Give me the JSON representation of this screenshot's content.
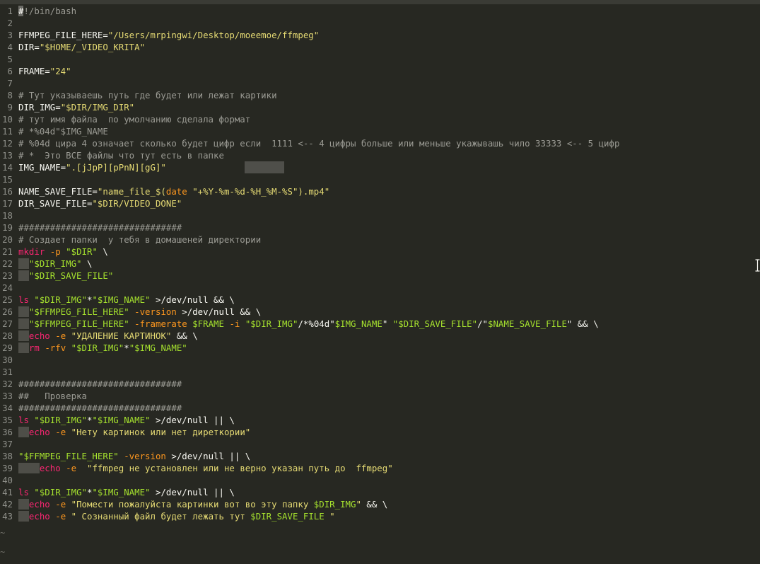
{
  "editor": {
    "lines": [
      {
        "n": "1",
        "tokens": [
          {
            "t": "#",
            "c": "cursor"
          },
          {
            "t": "!/bin/bash",
            "c": "cm"
          }
        ]
      },
      {
        "n": "2",
        "tokens": []
      },
      {
        "n": "3",
        "tokens": [
          {
            "t": "FFMPEG_FILE_HERE=",
            "c": "pl"
          },
          {
            "t": "\"/Users/mrpingwi/Desktop/moeemoe/ffmpeg\"",
            "c": "st"
          }
        ]
      },
      {
        "n": "4",
        "tokens": [
          {
            "t": "DIR=",
            "c": "pl"
          },
          {
            "t": "\"$HOME/_VIDEO_KRITA\"",
            "c": "st"
          }
        ]
      },
      {
        "n": "5",
        "tokens": []
      },
      {
        "n": "6",
        "tokens": [
          {
            "t": "FRAME=",
            "c": "pl"
          },
          {
            "t": "\"24\"",
            "c": "st"
          }
        ]
      },
      {
        "n": "7",
        "tokens": []
      },
      {
        "n": "8",
        "tokens": [
          {
            "t": "# Тут указываешь путь где будет или лежат картики",
            "c": "cm"
          }
        ]
      },
      {
        "n": "9",
        "tokens": [
          {
            "t": "DIR_IMG=",
            "c": "pl"
          },
          {
            "t": "\"$DIR/IMG_DIR\"",
            "c": "st"
          }
        ]
      },
      {
        "n": "10",
        "tokens": [
          {
            "t": "# тут имя файла  по умолчанию сделала формат",
            "c": "cm"
          }
        ]
      },
      {
        "n": "11",
        "tokens": [
          {
            "t": "# *%04d\"$IMG_NAME",
            "c": "cm"
          }
        ]
      },
      {
        "n": "12",
        "tokens": [
          {
            "t": "# %04d цира 4 означает сколько будет цифр если  1111 <-- 4 цифры больше или меньше укажывашь чило 33333 <-- 5 цифр",
            "c": "cm"
          }
        ]
      },
      {
        "n": "13",
        "tokens": [
          {
            "t": "# *  Это ВСЕ файлы что тут есть в папке",
            "c": "cm"
          }
        ]
      },
      {
        "n": "14",
        "tokens": [
          {
            "t": "IMG_NAME=",
            "c": "pl"
          },
          {
            "t": "\".[jJpP][pPnN][gG]\"",
            "c": "st"
          }
        ]
      },
      {
        "n": "15",
        "tokens": []
      },
      {
        "n": "16",
        "tokens": [
          {
            "t": "NAME_SAVE_FILE=",
            "c": "pl"
          },
          {
            "t": "\"name_file_$(",
            "c": "st"
          },
          {
            "t": "date",
            "c": "op"
          },
          {
            "t": " ",
            "c": "pl"
          },
          {
            "t": "\"+%Y-%m-%d-%H_%M-%S\"",
            "c": "st"
          },
          {
            "t": ").mp4\"",
            "c": "st"
          }
        ]
      },
      {
        "n": "17",
        "tokens": [
          {
            "t": "DIR_SAVE_FILE=",
            "c": "pl"
          },
          {
            "t": "\"$DIR/VIDEO_DONE\"",
            "c": "st"
          }
        ]
      },
      {
        "n": "18",
        "tokens": []
      },
      {
        "n": "19",
        "tokens": [
          {
            "t": "###############################",
            "c": "cm"
          }
        ]
      },
      {
        "n": "20",
        "tokens": [
          {
            "t": "# Создает папки  у тебя в домашеней директории",
            "c": "cm"
          }
        ]
      },
      {
        "n": "21",
        "tokens": [
          {
            "t": "mkdir",
            "c": "cd"
          },
          {
            "t": " ",
            "c": "pl"
          },
          {
            "t": "-p",
            "c": "op"
          },
          {
            "t": " ",
            "c": "pl"
          },
          {
            "t": "\"$DIR\"",
            "c": "vr"
          },
          {
            "t": " \\",
            "c": "pl"
          }
        ]
      },
      {
        "n": "22",
        "tokens": [
          {
            "t": "  ",
            "c": "ws"
          },
          {
            "t": "\"$DIR_IMG\"",
            "c": "vr"
          },
          {
            "t": " \\",
            "c": "pl"
          }
        ]
      },
      {
        "n": "23",
        "tokens": [
          {
            "t": "  ",
            "c": "ws"
          },
          {
            "t": "\"$DIR_SAVE_FILE\"",
            "c": "vr"
          }
        ]
      },
      {
        "n": "24",
        "tokens": []
      },
      {
        "n": "25",
        "tokens": [
          {
            "t": "ls",
            "c": "cd"
          },
          {
            "t": " ",
            "c": "pl"
          },
          {
            "t": "\"$DIR_IMG\"",
            "c": "vr"
          },
          {
            "t": "*",
            "c": "pl"
          },
          {
            "t": "\"$IMG_NAME\"",
            "c": "vr"
          },
          {
            "t": " >/dev/null && \\",
            "c": "pl"
          }
        ]
      },
      {
        "n": "26",
        "tokens": [
          {
            "t": "  ",
            "c": "ws"
          },
          {
            "t": "\"$FFMPEG_FILE_HERE\"",
            "c": "vr"
          },
          {
            "t": " ",
            "c": "pl"
          },
          {
            "t": "-version",
            "c": "op"
          },
          {
            "t": " >/dev/null && \\",
            "c": "pl"
          }
        ]
      },
      {
        "n": "27",
        "tokens": [
          {
            "t": "  ",
            "c": "ws"
          },
          {
            "t": "\"$FFMPEG_FILE_HERE\"",
            "c": "vr"
          },
          {
            "t": " ",
            "c": "pl"
          },
          {
            "t": "-framerate",
            "c": "op"
          },
          {
            "t": " ",
            "c": "pl"
          },
          {
            "t": "$FRAME",
            "c": "vr"
          },
          {
            "t": " ",
            "c": "pl"
          },
          {
            "t": "-i",
            "c": "op"
          },
          {
            "t": " ",
            "c": "pl"
          },
          {
            "t": "\"$DIR_IMG\"",
            "c": "vr"
          },
          {
            "t": "/*%04d\"",
            "c": "pl"
          },
          {
            "t": "$IMG_NAME",
            "c": "vr"
          },
          {
            "t": "\" ",
            "c": "pl"
          },
          {
            "t": "\"$DIR_SAVE_FILE\"",
            "c": "vr"
          },
          {
            "t": "/\"",
            "c": "pl"
          },
          {
            "t": "$NAME_SAVE_FILE",
            "c": "vr"
          },
          {
            "t": "\" && \\",
            "c": "pl"
          }
        ]
      },
      {
        "n": "28",
        "tokens": [
          {
            "t": "  ",
            "c": "ws"
          },
          {
            "t": "echo",
            "c": "cd"
          },
          {
            "t": " ",
            "c": "pl"
          },
          {
            "t": "-e",
            "c": "op"
          },
          {
            "t": " ",
            "c": "pl"
          },
          {
            "t": "\"УДАЛЕНИЕ КАРТИНОК\"",
            "c": "st"
          },
          {
            "t": " && \\",
            "c": "pl"
          }
        ]
      },
      {
        "n": "29",
        "tokens": [
          {
            "t": "  ",
            "c": "ws"
          },
          {
            "t": "rm",
            "c": "cd"
          },
          {
            "t": " ",
            "c": "pl"
          },
          {
            "t": "-rfv",
            "c": "op"
          },
          {
            "t": " ",
            "c": "pl"
          },
          {
            "t": "\"$DIR_IMG\"",
            "c": "vr"
          },
          {
            "t": "*",
            "c": "pl"
          },
          {
            "t": "\"$IMG_NAME\"",
            "c": "vr"
          }
        ]
      },
      {
        "n": "30",
        "tokens": []
      },
      {
        "n": "31",
        "tokens": []
      },
      {
        "n": "32",
        "tokens": [
          {
            "t": "###############################",
            "c": "cm"
          }
        ]
      },
      {
        "n": "33",
        "tokens": [
          {
            "t": "##   Проверка",
            "c": "cm"
          }
        ]
      },
      {
        "n": "34",
        "tokens": [
          {
            "t": "###############################",
            "c": "cm"
          }
        ]
      },
      {
        "n": "35",
        "tokens": [
          {
            "t": "ls",
            "c": "cd"
          },
          {
            "t": " ",
            "c": "pl"
          },
          {
            "t": "\"$DIR_IMG\"",
            "c": "vr"
          },
          {
            "t": "*",
            "c": "pl"
          },
          {
            "t": "\"$IMG_NAME\"",
            "c": "vr"
          },
          {
            "t": " >/dev/null || \\",
            "c": "pl"
          }
        ]
      },
      {
        "n": "36",
        "tokens": [
          {
            "t": "  ",
            "c": "ws"
          },
          {
            "t": "echo",
            "c": "cd"
          },
          {
            "t": " ",
            "c": "pl"
          },
          {
            "t": "-e",
            "c": "op"
          },
          {
            "t": " ",
            "c": "pl"
          },
          {
            "t": "\"Нету картинок или нет диреткории\"",
            "c": "st"
          }
        ]
      },
      {
        "n": "37",
        "tokens": []
      },
      {
        "n": "38",
        "tokens": [
          {
            "t": "\"$FFMPEG_FILE_HERE\"",
            "c": "vr"
          },
          {
            "t": " ",
            "c": "pl"
          },
          {
            "t": "-version",
            "c": "op"
          },
          {
            "t": " >/dev/null || \\",
            "c": "pl"
          }
        ]
      },
      {
        "n": "39",
        "tokens": [
          {
            "t": "    ",
            "c": "ws"
          },
          {
            "t": "echo",
            "c": "cd"
          },
          {
            "t": " ",
            "c": "pl"
          },
          {
            "t": "-e",
            "c": "op"
          },
          {
            "t": "  ",
            "c": "pl"
          },
          {
            "t": "\"ffmpeg не установлен или не верно указан путь до  ffmpeg\"",
            "c": "st"
          }
        ]
      },
      {
        "n": "40",
        "tokens": []
      },
      {
        "n": "41",
        "tokens": [
          {
            "t": "ls",
            "c": "cd"
          },
          {
            "t": " ",
            "c": "pl"
          },
          {
            "t": "\"$DIR_IMG\"",
            "c": "vr"
          },
          {
            "t": "*",
            "c": "pl"
          },
          {
            "t": "\"$IMG_NAME\"",
            "c": "vr"
          },
          {
            "t": " >/dev/null || \\",
            "c": "pl"
          }
        ]
      },
      {
        "n": "42",
        "tokens": [
          {
            "t": "  ",
            "c": "ws"
          },
          {
            "t": "echo",
            "c": "cd"
          },
          {
            "t": " ",
            "c": "pl"
          },
          {
            "t": "-e",
            "c": "op"
          },
          {
            "t": " ",
            "c": "pl"
          },
          {
            "t": "\"Помести пожалуйста картинки вот во эту папку ",
            "c": "st"
          },
          {
            "t": "$DIR_IMG",
            "c": "vr"
          },
          {
            "t": "\"",
            "c": "st"
          },
          {
            "t": " && \\",
            "c": "pl"
          }
        ]
      },
      {
        "n": "43",
        "tokens": [
          {
            "t": "  ",
            "c": "ws"
          },
          {
            "t": "echo",
            "c": "cd"
          },
          {
            "t": " ",
            "c": "pl"
          },
          {
            "t": "-e",
            "c": "op"
          },
          {
            "t": " ",
            "c": "pl"
          },
          {
            "t": "\" Сознанный файл будет лежать тут ",
            "c": "st"
          },
          {
            "t": "$DIR_SAVE_FILE",
            "c": "vr"
          },
          {
            "t": " \"",
            "c": "st"
          }
        ]
      }
    ],
    "tildes": [
      "~",
      "~"
    ]
  },
  "colors": {
    "background": "#272822",
    "line_number": "#8f908a",
    "comment": "#9b9b94",
    "string": "#e6db74",
    "variable": "#a6e22e",
    "command": "#f92672",
    "option": "#fd971f",
    "plain": "#f8f8f2"
  },
  "icons": {
    "mouse_pointer": "text-cursor-ibeam-icon"
  }
}
